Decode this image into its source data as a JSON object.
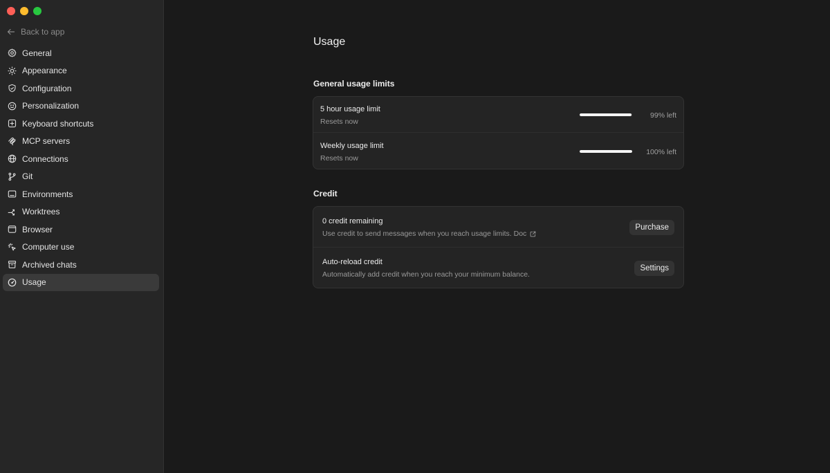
{
  "window": {
    "traffic_lights": {
      "close": "#ff5f57",
      "minimize": "#febc2e",
      "zoom": "#28c840"
    }
  },
  "sidebar": {
    "back_label": "Back to app",
    "back_icon": "arrow-left-icon",
    "items": [
      {
        "label": "General",
        "icon": "gear-icon"
      },
      {
        "label": "Appearance",
        "icon": "sun-icon"
      },
      {
        "label": "Configuration",
        "icon": "shield-icon"
      },
      {
        "label": "Personalization",
        "icon": "smiley-icon"
      },
      {
        "label": "Keyboard shortcuts",
        "icon": "command-key-icon"
      },
      {
        "label": "MCP servers",
        "icon": "mcp-icon"
      },
      {
        "label": "Connections",
        "icon": "globe-icon"
      },
      {
        "label": "Git",
        "icon": "git-branch-icon"
      },
      {
        "label": "Environments",
        "icon": "terminal-icon"
      },
      {
        "label": "Worktrees",
        "icon": "worktree-icon"
      },
      {
        "label": "Browser",
        "icon": "browser-window-icon"
      },
      {
        "label": "Computer use",
        "icon": "cursor-click-icon"
      },
      {
        "label": "Archived chats",
        "icon": "archive-icon"
      },
      {
        "label": "Usage",
        "icon": "gauge-icon",
        "active": true
      }
    ]
  },
  "main": {
    "title": "Usage",
    "limits": {
      "heading": "General usage limits",
      "rows": [
        {
          "title": "5 hour usage limit",
          "subtitle": "Resets now",
          "remaining_fraction": 0.99,
          "percent_label": "99% left"
        },
        {
          "title": "Weekly usage limit",
          "subtitle": "Resets now",
          "remaining_fraction": 1.0,
          "percent_label": "100% left"
        }
      ]
    },
    "credit": {
      "heading": "Credit",
      "rows": [
        {
          "title": "0 credit remaining",
          "subtitle": "Use credit to send messages when you reach usage limits. Doc",
          "link_icon": "external-link-icon",
          "button": "Purchase"
        },
        {
          "title": "Auto-reload credit",
          "subtitle": "Automatically add credit when you reach your minimum balance.",
          "button": "Settings"
        }
      ]
    }
  }
}
